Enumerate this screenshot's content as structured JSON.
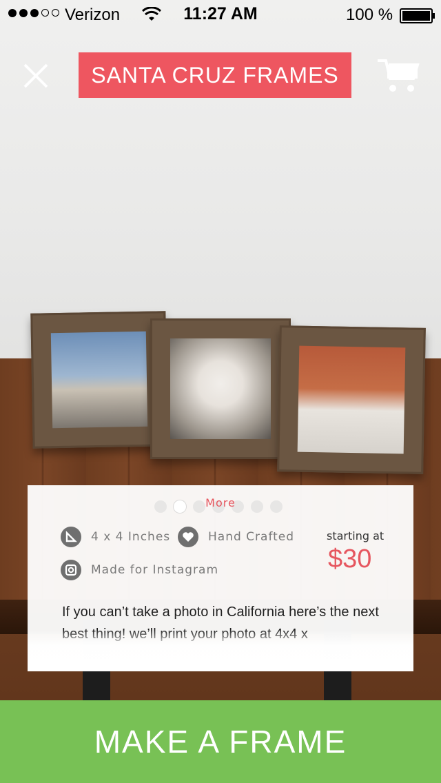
{
  "status_bar": {
    "carrier": "Verizon",
    "time": "11:27 AM",
    "battery": "100 %",
    "signal_bars": 3,
    "signal_total": 5
  },
  "header": {
    "title": "SANTA CRUZ FRAMES",
    "close_icon": "close-icon",
    "cart_icon": "cart-icon"
  },
  "card": {
    "more_label": "More",
    "pager": {
      "total": 7,
      "active": 2
    },
    "features": [
      {
        "icon": "ruler-icon",
        "label": "4 x 4 Inches"
      },
      {
        "icon": "heart-icon",
        "label": "Hand Crafted"
      },
      {
        "icon": "instagram-icon",
        "label": "Made for Instagram"
      }
    ],
    "price_label": "starting at",
    "price": "$30",
    "description": "If you can’t take a photo in California here’s the next best thing! we’ll print your photo at 4x4 x"
  },
  "cta": {
    "label": "MAKE A FRAME"
  },
  "colors": {
    "accent": "#ee5660",
    "cta": "#78c155",
    "icon_gray": "#6f6f6f"
  }
}
